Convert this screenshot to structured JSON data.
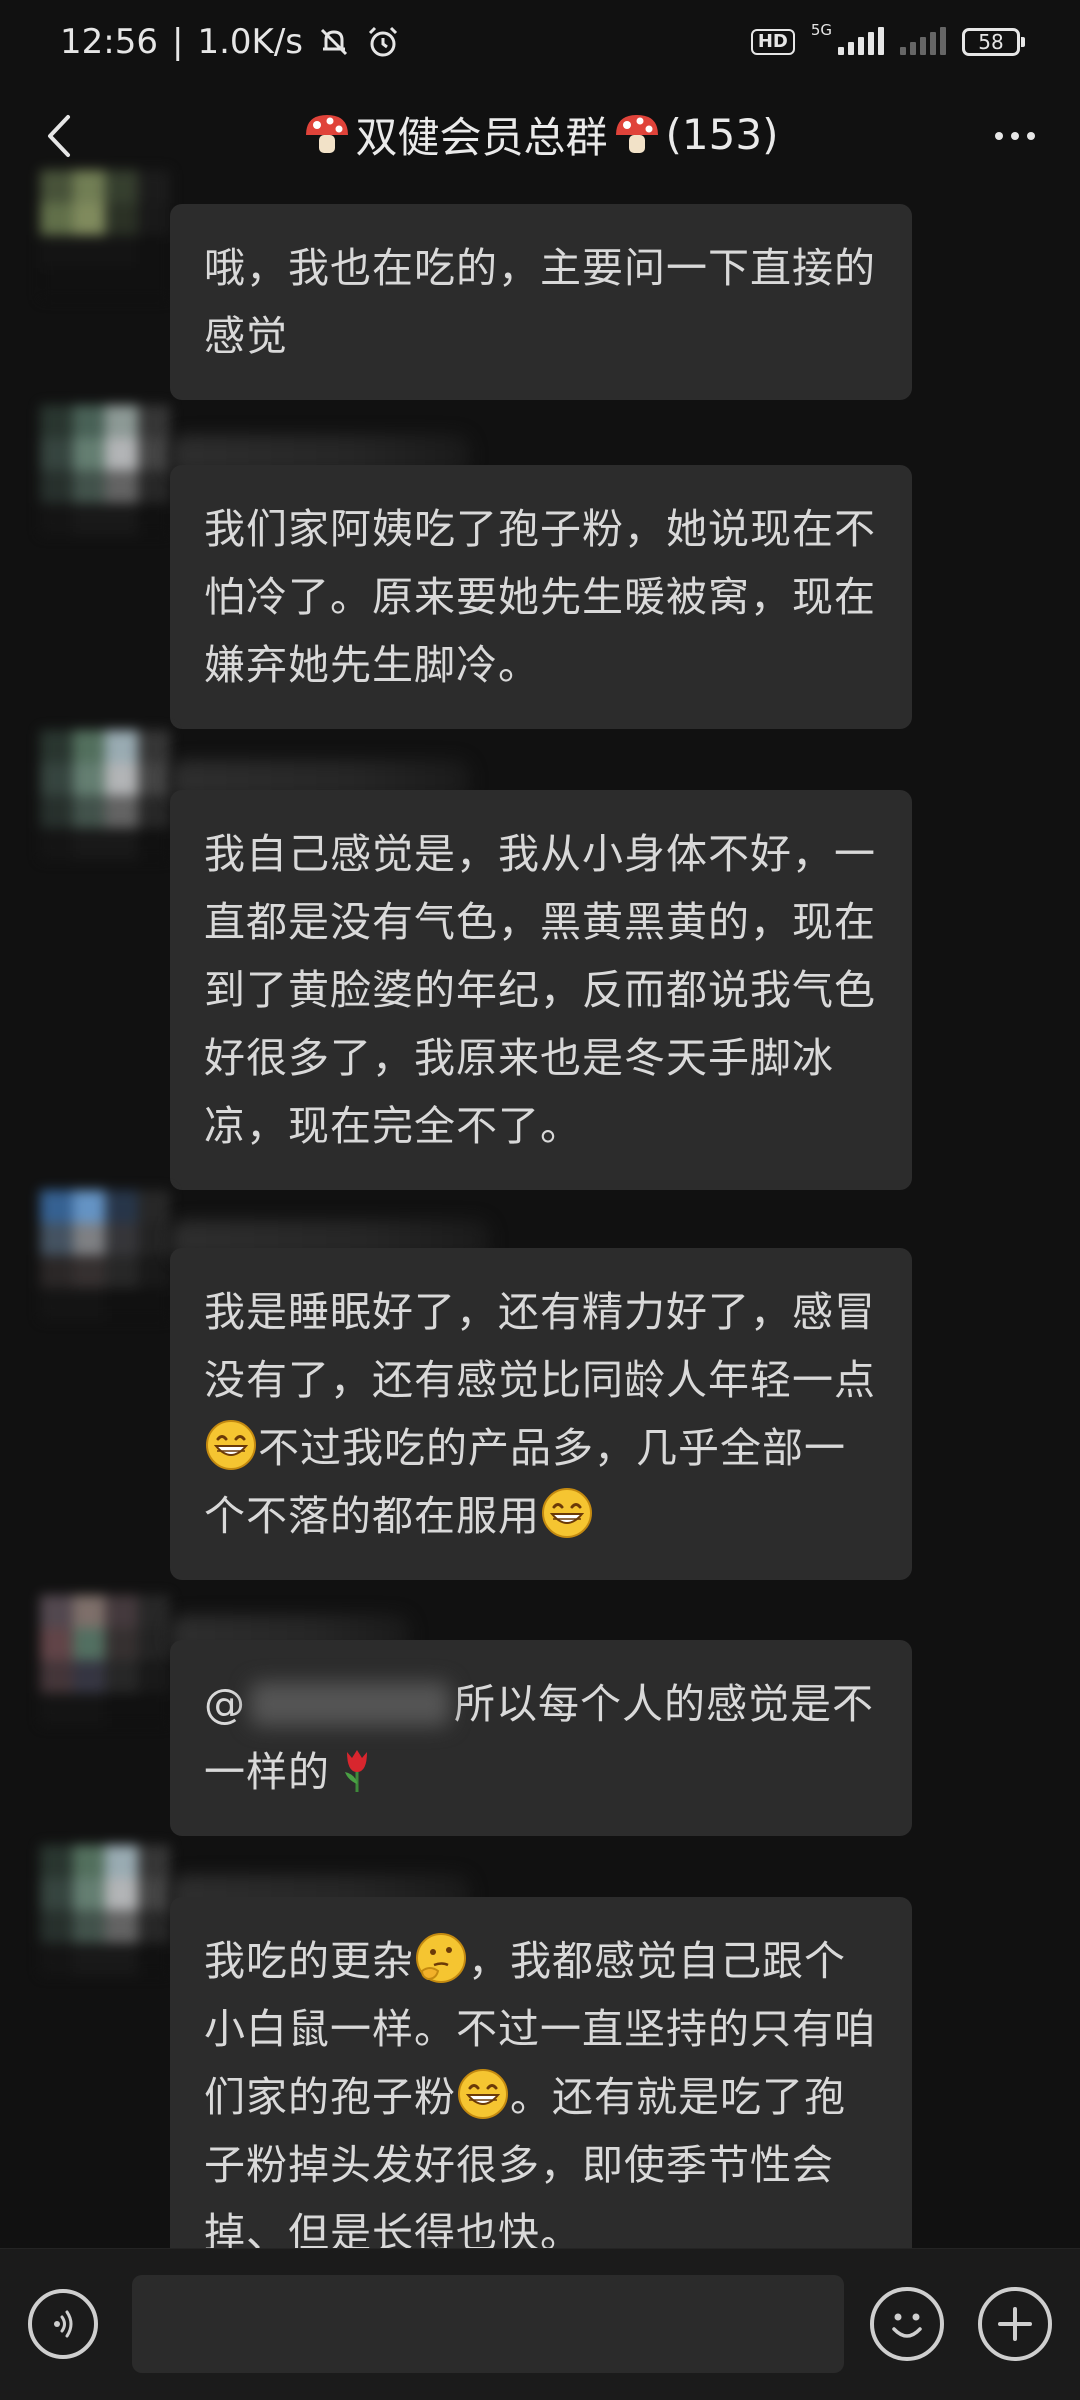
{
  "status_bar": {
    "time": "12:56",
    "speed": "1.0K/s",
    "network": "5G",
    "hd": "HD",
    "battery": "58"
  },
  "header": {
    "title": "双健会员总群",
    "member_count": "(153)",
    "title_icon": "mushroom-icon",
    "back_icon": "chevron-left-icon",
    "more_icon": "more-dots-icon"
  },
  "messages": [
    {
      "text": "哦，我也在吃的，主要问一下直接的感觉"
    },
    {
      "text": "我们家阿姨吃了孢子粉，她说现在不怕冷了。原来要她先生暖被窝，现在嫌弃她先生脚冷。"
    },
    {
      "text": "我自己感觉是，我从小身体不好，一直都是没有气色，黑黄黑黄的，现在到了黄脸婆的年纪，反而都说我气色好很多了，我原来也是冬天手脚冰凉，现在完全不了。"
    },
    {
      "part1": "我是睡眠好了，还有精力好了，感冒没有了，还有感觉比同龄人年轻一点",
      "part2": "不过我吃的产品多，几乎全部一个不落的都在服用"
    },
    {
      "mention_prefix": "@",
      "text": "所以每个人的感觉是不一样的"
    },
    {
      "part1": "我吃的更杂",
      "part2": "，我都感觉自己跟个小白鼠一样。不过一直坚持的只有咱们家的孢子粉",
      "part3": "。还有就是吃了孢子粉掉头发好很多，即使季节性会掉、但是长得也快。"
    }
  ],
  "input_bar": {
    "voice_icon": "voice-icon",
    "emoji_icon": "emoji-icon",
    "plus_icon": "plus-icon",
    "placeholder": ""
  },
  "colors": {
    "background": "#111111",
    "bubble": "#2c2c2c",
    "text": "#d9d9d9",
    "mushroom_red": "#e0433a"
  }
}
